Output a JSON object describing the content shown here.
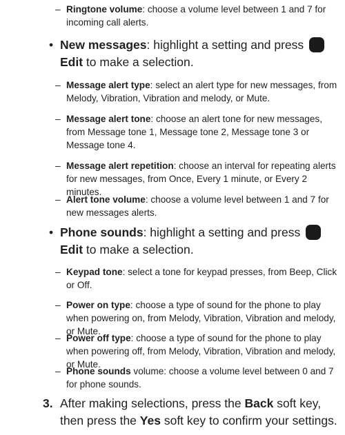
{
  "ringtone_volume": {
    "term": "Ringtone volume",
    "text": ": choose a volume level between 1 and 7 for incoming call alerts."
  },
  "new_messages": {
    "term": "New messages",
    "before_key": ": highlight a setting and press ",
    "key_label": "Edit",
    "after_key": " to make a selection.",
    "items": [
      {
        "term": "Message alert type",
        "text": ": select an alert type for new messages, from Melody, Vibration, Vibration and melody, or Mute."
      },
      {
        "term": "Message alert tone",
        "text": ": choose an alert tone for new messages, from Message tone 1, Message tone 2, Message tone 3 or Message tone 4."
      },
      {
        "term": "Message alert repetition",
        "text": ": choose an interval for repeating alerts for new messages, from Once, Every 1 minute, or Every 2 minutes."
      },
      {
        "term": "Alert tone volume",
        "text": ": choose a volume level between 1 and 7 for new messages alerts."
      }
    ]
  },
  "phone_sounds": {
    "term": "Phone sounds",
    "before_key": ": highlight a setting and press ",
    "key_label": "Edit",
    "after_key": " to make a selection.",
    "items": [
      {
        "term": "Keypad tone",
        "text": ": select a tone for keypad presses, from Beep, Click or Off."
      },
      {
        "term": "Power on type",
        "text": ": choose a type of sound for the phone to play when powering on, from Melody, Vibration, Vibration and melody, or Mute."
      },
      {
        "term": "Power off type",
        "text": ": choose a type of sound for the phone to play when powering off, from Melody, Vibration, Vibration and melody, or Mute."
      },
      {
        "term": "Phone sounds",
        "text": " volume: choose a volume level between 0 and 7 for phone sounds."
      }
    ]
  },
  "step3": {
    "number": "3.",
    "p1": "After making selections, press the ",
    "back": "Back",
    "p2": " soft key, then press the ",
    "yes": "Yes",
    "p3": " soft key to confirm your settings."
  },
  "bullet": "•",
  "dash": "–"
}
